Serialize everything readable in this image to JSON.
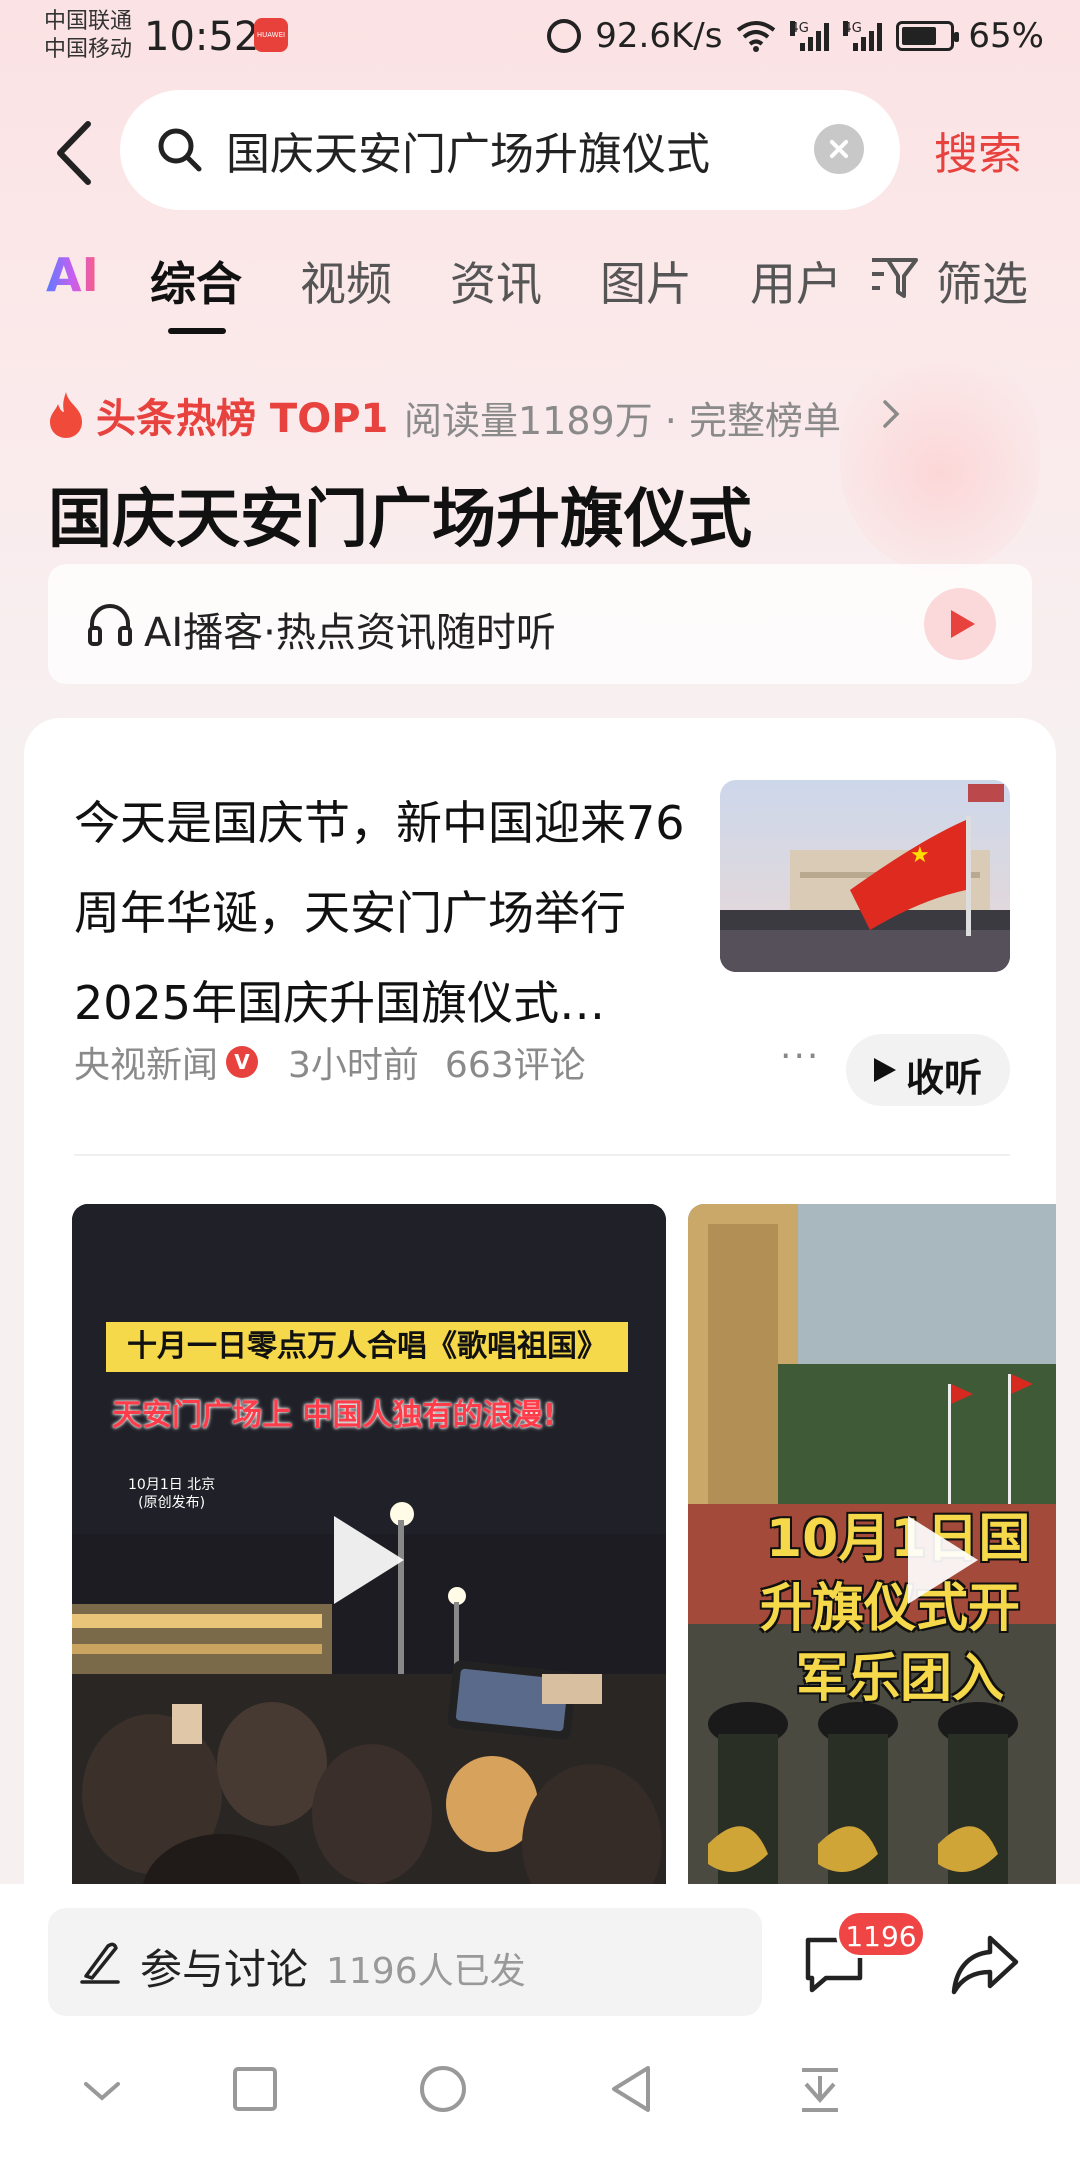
{
  "status_bar": {
    "carrier1": "中国联通",
    "carrier2": "中国移动",
    "time": "10:52",
    "badge": "HUAWEI",
    "net_speed": "92.6K/s",
    "sig_gen": "4G",
    "battery": "65%",
    "battery_level": 0.65
  },
  "search": {
    "query": "国庆天安门广场升旗仪式",
    "button": "搜索"
  },
  "tabs": {
    "ai": "AI",
    "items": [
      "综合",
      "视频",
      "资讯",
      "图片",
      "用户"
    ],
    "filter": "筛选"
  },
  "hot": {
    "label": "头条热榜 TOP1",
    "stats": "阅读量1189万 · 完整榜单"
  },
  "topic_title": "国庆天安门广场升旗仪式",
  "podcast": {
    "label": "AI播客·热点资讯随时听"
  },
  "article": {
    "text": "今天是国庆节，新中国迎来76周年华诞，天安门广场举行2025年国庆升国旗仪式…",
    "source": "央视新闻",
    "verified": "V",
    "time": "3小时前",
    "comments": "663评论",
    "more": "···",
    "listen": "收听"
  },
  "videos": [
    {
      "caption1": "十月一日零点万人合唱《歌唱祖国》",
      "caption2": "天安门广场上 中国人独有的浪漫!",
      "date": "10月1日 北京",
      "date_sub": "(原创发布)"
    },
    {
      "caption_line1": "10月1日国",
      "caption_line2": "升旗仪式开",
      "caption_line3": "军乐团入"
    }
  ],
  "bottom": {
    "discuss_label": "参与讨论",
    "discuss_count": "1196人已发",
    "comment_badge": "1196"
  },
  "colors": {
    "accent": "#e8423f",
    "badge": "#f04545",
    "caption_yellow": "#f5d94a"
  }
}
